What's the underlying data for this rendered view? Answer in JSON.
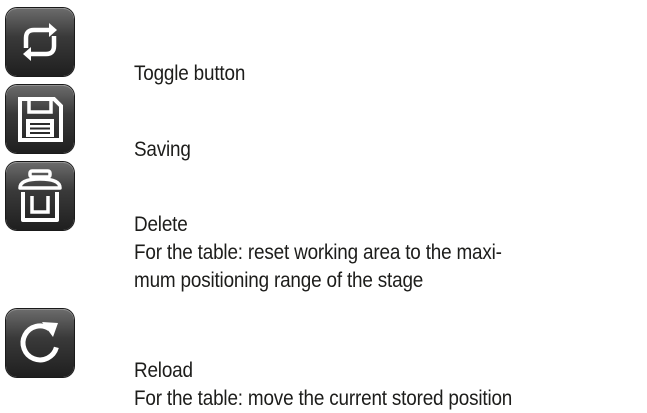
{
  "entries": [
    {
      "icon": "toggle-icon",
      "title": "Toggle button"
    },
    {
      "icon": "save-icon",
      "title": "Saving"
    },
    {
      "icon": "trash-icon",
      "title": "Delete",
      "desc": [
        "For the table: reset working area to the maxi-",
        "mum positioning range of the stage"
      ]
    },
    {
      "icon": "reload-icon",
      "title": "Reload",
      "desc": [
        "For the table: move the current stored position"
      ]
    }
  ],
  "colors": {
    "icon_background": "#2a2a2a",
    "icon_glyph": "#ffffff",
    "text": "#1d1d1b"
  }
}
